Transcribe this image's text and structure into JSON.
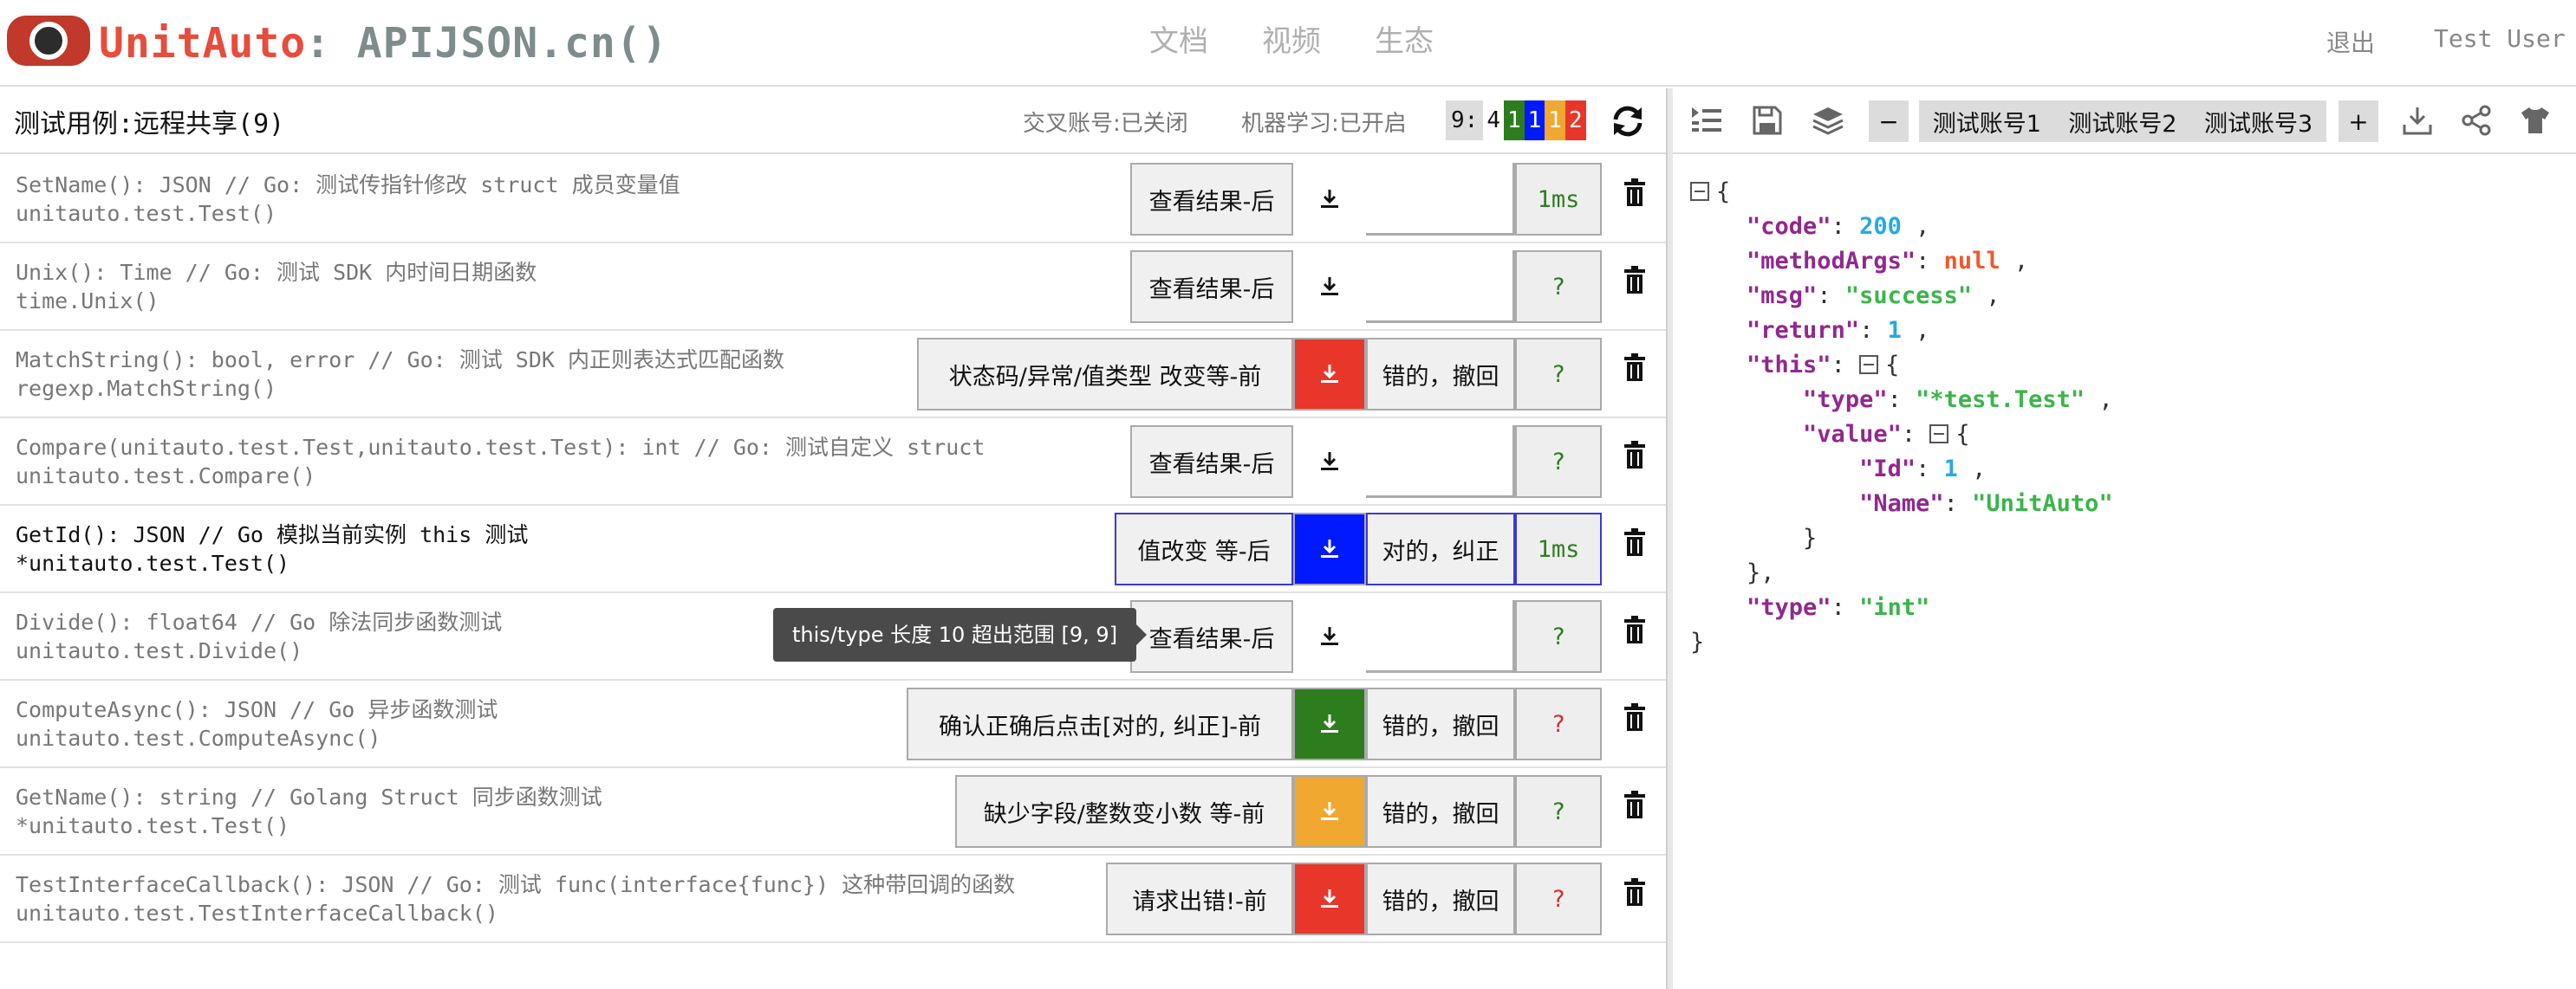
{
  "header": {
    "brand": "UnitAuto",
    "sub_brand": ": APIJSON.cn()",
    "nav": [
      "文档",
      "视频",
      "生态"
    ],
    "logout": "退出",
    "user": "Test User"
  },
  "left": {
    "case_title": "测试用例:远程共享(9)",
    "cross_account": "交叉账号:已关闭",
    "ml": "机器学习:已开启",
    "stats": {
      "total": "9:",
      "white": "4",
      "green": "1",
      "blue": "1",
      "orange": "1",
      "red": "2"
    },
    "tooltip": "this/type 长度 10 超出范围 [9, 9]",
    "rows": [
      {
        "l1": "SetName(): JSON // Go: 测试传指针修改 struct 成员变量值",
        "l2": "unitauto.test.Test()",
        "action": "查看结果-后",
        "time": "1ms"
      },
      {
        "l1": "Unix(): Time // Go: 测试 SDK 内时间日期函数",
        "l2": "time.Unix()",
        "action": "查看结果-后",
        "time": "?"
      },
      {
        "l1": "MatchString(): bool, error // Go: 测试 SDK 内正则表达式匹配函数",
        "l2": "regexp.MatchString()",
        "action": "状态码/异常/值类型 改变等-前",
        "judge": "错的，撤回",
        "time": "?"
      },
      {
        "l1": "Compare(unitauto.test.Test,unitauto.test.Test): int // Go: 测试自定义 struct",
        "l2": "unitauto.test.Compare()",
        "action": "查看结果-后",
        "time": "?"
      },
      {
        "l1": "GetId(): JSON // Go 模拟当前实例 this 测试",
        "l2": "*unitauto.test.Test()",
        "action": "值改变  等-后",
        "judge": "对的，纠正",
        "time": "1ms"
      },
      {
        "l1": "Divide(): float64 // Go 除法同步函数测试",
        "l2": "unitauto.test.Divide()",
        "action": "查看结果-后",
        "time": "?"
      },
      {
        "l1": "ComputeAsync(): JSON // Go 异步函数测试",
        "l2": "unitauto.test.ComputeAsync()",
        "action": "确认正确后点击[对的, 纠正]-前",
        "judge": "错的，撤回",
        "time": "?"
      },
      {
        "l1": "GetName(): string // Golang Struct 同步函数测试",
        "l2": "*unitauto.test.Test()",
        "action": "缺少字段/整数变小数 等-前",
        "judge": "错的，撤回",
        "time": "?"
      },
      {
        "l1": "TestInterfaceCallback(): JSON // Go: 测试 func(interface{func}) 这种带回调的函数",
        "l2": "unitauto.test.TestInterfaceCallback()",
        "action": "请求出错!-前",
        "judge": "错的，撤回",
        "time": "?"
      }
    ]
  },
  "right": {
    "minus": "−",
    "plus": "+",
    "accounts": [
      "测试账号1",
      "测试账号2",
      "测试账号3"
    ],
    "json": {
      "open": "{",
      "code_k": "\"code\"",
      "code_v": "200",
      "methodArgs_k": "\"methodArgs\"",
      "methodArgs_v": "null",
      "msg_k": "\"msg\"",
      "msg_v": "\"success\"",
      "return_k": "\"return\"",
      "return_v": "1",
      "this_k": "\"this\"",
      "type_k": "\"type\"",
      "type_v": "\"*test.Test\"",
      "value_k": "\"value\"",
      "id_k": "\"Id\"",
      "id_v": "1",
      "name_k": "\"Name\"",
      "name_v": "\"UnitAuto\"",
      "type2_k": "\"type\"",
      "type2_v": "\"int\""
    }
  },
  "colors": {
    "brand": "#e74c3c",
    "green": "#2d7d1f",
    "blue": "#0019ff",
    "orange": "#f0a830",
    "red": "#e8362a"
  }
}
